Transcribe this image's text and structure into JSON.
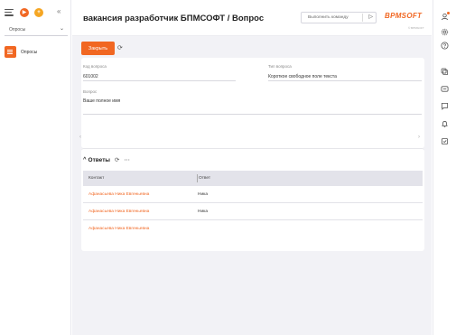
{
  "sidebar": {
    "section_select": "Опросы",
    "nav_item": "Опросы"
  },
  "header": {
    "title": "вакансия разработчик БПМСОФТ / Вопрос",
    "command_placeholder": "Выполнить команду",
    "logo": "BPMSOFT",
    "logo_sub": "© BPMSOFT"
  },
  "toolbar": {
    "close_label": "Закрыть"
  },
  "form": {
    "code_label": "Код вопроса",
    "code_value": "601002",
    "type_label": "Тип вопроса",
    "type_value": "Короткое свободное поле текста",
    "question_label": "Вопрос",
    "question_value": "Ваше полное имя"
  },
  "answers": {
    "title": "Ответы",
    "col_contact": "Контакт",
    "col_answer": "Ответ",
    "rows": [
      {
        "contact": "Афанасьева Ника Евгеньевна",
        "answer": "Ника"
      },
      {
        "contact": "Афанасьева Ника Евгеньевна",
        "answer": "Ника"
      },
      {
        "contact": "Афанасьева Ника Евгеньевна",
        "answer": ""
      }
    ]
  },
  "colors": {
    "accent": "#f16722",
    "background": "#f2f2f6"
  }
}
